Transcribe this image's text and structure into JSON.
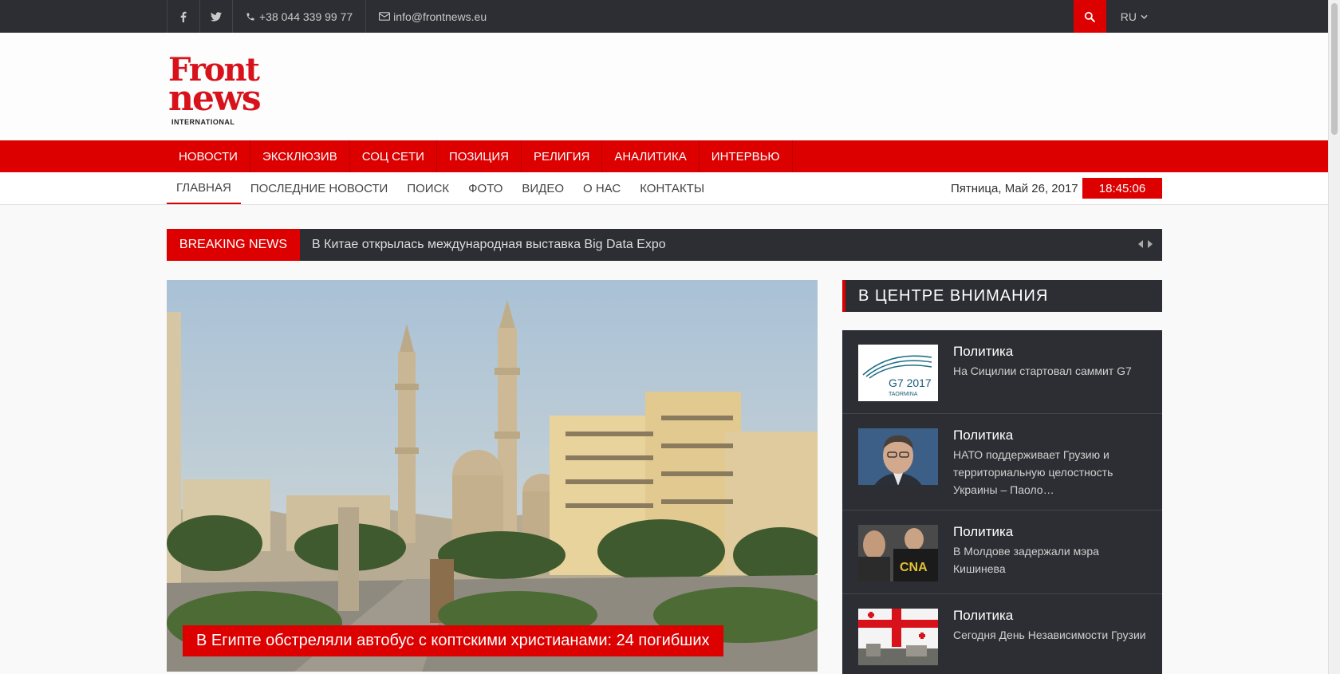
{
  "topbar": {
    "phone": "+38 044 339 99 77",
    "email": "info@frontnews.eu",
    "language": "RU"
  },
  "logo": {
    "line1": "Front",
    "line2": "news",
    "line3": "INTERNATIONAL"
  },
  "main_nav": [
    "НОВОСТИ",
    "ЭКСКЛЮЗИВ",
    "СОЦ СЕТИ",
    "ПОЗИЦИЯ",
    "РЕЛИГИЯ",
    "АНАЛИТИКА",
    "ИНТЕРВЬЮ"
  ],
  "sub_nav": [
    "ГЛАВНАЯ",
    "ПОСЛЕДНИЕ НОВОСТИ",
    "ПОИСК",
    "ФОТО",
    "ВИДЕО",
    "О НАС",
    "КОНТАКТЫ"
  ],
  "date_text": "Пятница, Май 26, 2017",
  "clock": "18:45:06",
  "breaking": {
    "label": "BREAKING NEWS",
    "headline": "В Китае открылась международная выставка Big Data Expo"
  },
  "hero": {
    "caption": "В Египте обстреляли автобус с коптскими христианами: 24 погибших"
  },
  "sidebar": {
    "title": "В ЦЕНТРЕ ВНИМАНИЯ",
    "items": [
      {
        "category": "Политика",
        "title": "На Сицилии стартовал саммит G7",
        "thumb_text_1": "G7 2017",
        "thumb_text_2": "TAORMINA"
      },
      {
        "category": "Политика",
        "title": "НАТО поддерживает Грузию и территориальную целостность Украины – Паоло…"
      },
      {
        "category": "Политика",
        "title": "В Молдове задержали мэра Кишинева",
        "thumb_text_1": "CNA"
      },
      {
        "category": "Политика",
        "title": "Сегодня День Независимости Грузии"
      }
    ]
  },
  "colors": {
    "accent": "#dc0000",
    "dark": "#2d2e33"
  }
}
